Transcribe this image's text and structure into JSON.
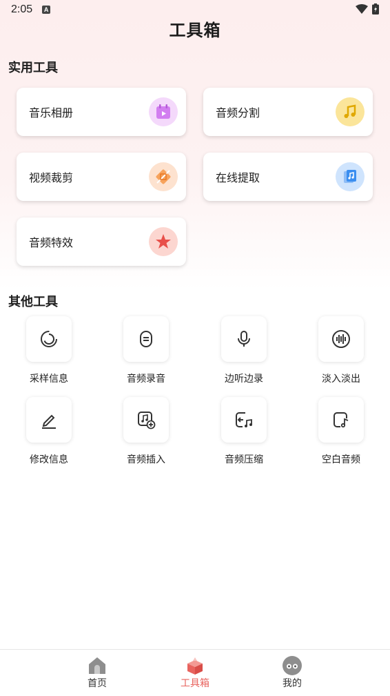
{
  "status": {
    "time": "2:05",
    "badge": "A"
  },
  "header": {
    "title": "工具箱"
  },
  "sections": {
    "practical": {
      "title": "实用工具",
      "items": [
        {
          "label": "音乐相册",
          "icon": "calendar-play-icon",
          "color": "#c46ae0"
        },
        {
          "label": "音频分割",
          "icon": "music-note-icon",
          "color": "#f2b818"
        },
        {
          "label": "视频裁剪",
          "icon": "crop-icon",
          "color": "#f08a3a"
        },
        {
          "label": "在线提取",
          "icon": "music-file-icon",
          "color": "#3a8ef0"
        },
        {
          "label": "音频特效",
          "icon": "star-icon",
          "color": "#e8504a"
        }
      ]
    },
    "other": {
      "title": "其他工具",
      "items": [
        {
          "label": "采样信息",
          "icon": "loading-ring-icon"
        },
        {
          "label": "音频录音",
          "icon": "record-icon"
        },
        {
          "label": "边听边录",
          "icon": "microphone-icon"
        },
        {
          "label": "淡入淡出",
          "icon": "waveform-icon"
        },
        {
          "label": "修改信息",
          "icon": "edit-icon"
        },
        {
          "label": "音频插入",
          "icon": "music-add-icon"
        },
        {
          "label": "音频压缩",
          "icon": "compress-icon"
        },
        {
          "label": "空白音频",
          "icon": "blank-audio-icon"
        }
      ]
    }
  },
  "tabbar": {
    "items": [
      {
        "label": "首页",
        "icon": "home-icon"
      },
      {
        "label": "工具箱",
        "icon": "toolbox-icon",
        "active": true
      },
      {
        "label": "我的",
        "icon": "profile-icon"
      }
    ],
    "active_color": "#e8635e"
  }
}
